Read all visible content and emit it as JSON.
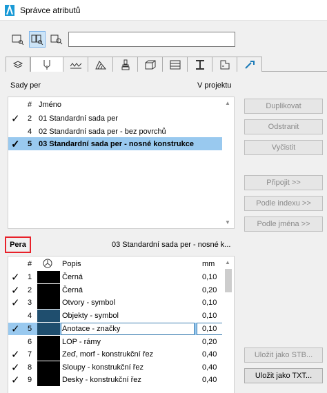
{
  "window": {
    "title": "Správce atributů"
  },
  "toolbar": {
    "buttons": [
      "table-view-icon",
      "grid-view-icon",
      "search-view-icon"
    ],
    "search_value": ""
  },
  "tabs": [
    "layers-icon",
    "pen-icon",
    "line-type-icon",
    "fill-icon",
    "surface-icon",
    "building-material-icon",
    "composite-icon",
    "profile-icon",
    "zone-icon",
    "mep-icon"
  ],
  "sets": {
    "label": "Sady per",
    "in_project": "V projektu",
    "header": {
      "num": "#",
      "name": "Jméno"
    },
    "rows": [
      {
        "check": true,
        "num": "2",
        "name": "01 Standardní sada per"
      },
      {
        "check": false,
        "num": "4",
        "name": "02 Standardní sada per - bez povrchů"
      },
      {
        "check": true,
        "num": "5",
        "name": "03 Standardní sada per - nosné konstrukce"
      }
    ]
  },
  "buttons": {
    "duplicate": "Duplikovat",
    "remove": "Odstranit",
    "clean": "Vyčistit",
    "append": "Připojit >>",
    "by_index": "Podle indexu >>",
    "by_name": "Podle jména >>",
    "save_stb": "Uložit jako STB...",
    "save_txt": "Uložit jako TXT..."
  },
  "pens": {
    "label": "Pera",
    "set_name": "03 Standardní sada per - nosné k...",
    "header": {
      "num": "#",
      "desc": "Popis",
      "mm": "mm"
    },
    "rows": [
      {
        "check": true,
        "num": "1",
        "color": "#000000",
        "desc": "Černá",
        "mm": "0,10"
      },
      {
        "check": true,
        "num": "2",
        "color": "#000000",
        "desc": "Černá",
        "mm": "0,20"
      },
      {
        "check": true,
        "num": "3",
        "color": "#000000",
        "desc": "Otvory - symbol",
        "mm": "0,10"
      },
      {
        "check": false,
        "num": "4",
        "color": "#1f4e6e",
        "desc": "Objekty - symbol",
        "mm": "0,10"
      },
      {
        "check": true,
        "num": "5",
        "color": "#1f4e6e",
        "desc": "Anotace - značky",
        "mm": "0,10"
      },
      {
        "check": false,
        "num": "6",
        "color": "#000000",
        "desc": "LOP - rámy",
        "mm": "0,20"
      },
      {
        "check": true,
        "num": "7",
        "color": "#000000",
        "desc": "Zeď, morf - konstrukční řez",
        "mm": "0,40"
      },
      {
        "check": true,
        "num": "8",
        "color": "#000000",
        "desc": "Sloupy - konstrukční řez",
        "mm": "0,40"
      },
      {
        "check": true,
        "num": "9",
        "color": "#000000",
        "desc": "Desky - konstrukční řez",
        "mm": "0,40"
      }
    ]
  }
}
